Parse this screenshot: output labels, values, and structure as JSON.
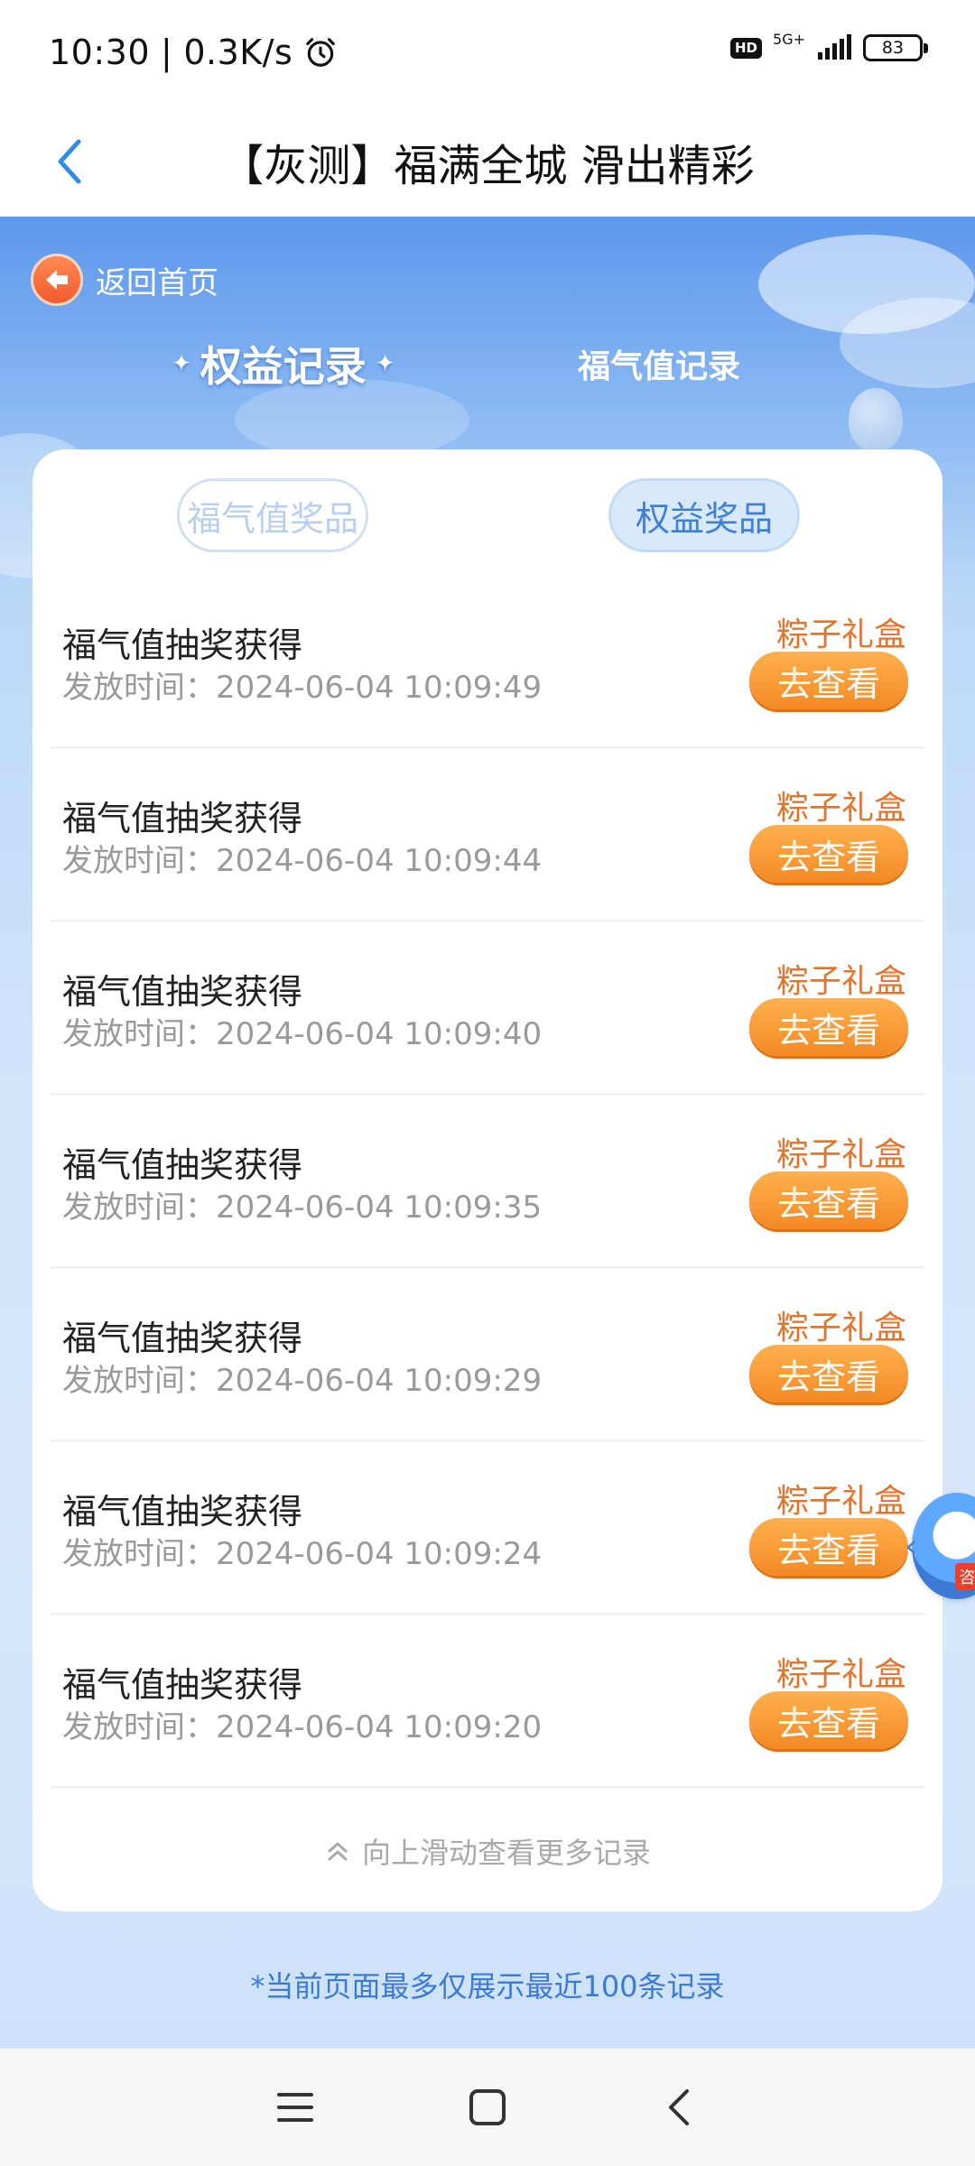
{
  "status_bar": {
    "time": "10:30",
    "speed": "0.3K/s",
    "hd": "HD",
    "network": "5G+",
    "battery": "83"
  },
  "nav": {
    "title": "【灰测】福满全城 滑出精彩"
  },
  "hero": {
    "back_home": "返回首页",
    "tab_active": "权益记录",
    "tab_inactive": "福气值记录"
  },
  "sub_tabs": {
    "left": "福气值奖品",
    "right": "权益奖品"
  },
  "records": [
    {
      "title": "福气值抽奖获得",
      "time_label": "发放时间：",
      "time": "2024-06-04 10:09:49",
      "prize": "粽子礼盒",
      "button": "去查看"
    },
    {
      "title": "福气值抽奖获得",
      "time_label": "发放时间：",
      "time": "2024-06-04 10:09:44",
      "prize": "粽子礼盒",
      "button": "去查看"
    },
    {
      "title": "福气值抽奖获得",
      "time_label": "发放时间：",
      "time": "2024-06-04 10:09:40",
      "prize": "粽子礼盒",
      "button": "去查看"
    },
    {
      "title": "福气值抽奖获得",
      "time_label": "发放时间：",
      "time": "2024-06-04 10:09:35",
      "prize": "粽子礼盒",
      "button": "去查看"
    },
    {
      "title": "福气值抽奖获得",
      "time_label": "发放时间：",
      "time": "2024-06-04 10:09:29",
      "prize": "粽子礼盒",
      "button": "去查看"
    },
    {
      "title": "福气值抽奖获得",
      "time_label": "发放时间：",
      "time": "2024-06-04 10:09:24",
      "prize": "粽子礼盒",
      "button": "去查看"
    },
    {
      "title": "福气值抽奖获得",
      "time_label": "发放时间：",
      "time": "2024-06-04 10:09:20",
      "prize": "粽子礼盒",
      "button": "去查看"
    }
  ],
  "more_hint": "向上滑动查看更多记录",
  "footer_note": "*当前页面最多仅展示最近100条记录",
  "float_service": {
    "label": "咨"
  },
  "icons": {
    "alarm": "alarm-clock-icon",
    "back": "chevron-left-icon",
    "home_back": "arrow-left-icon",
    "more": "double-chevron-up-icon",
    "menu": "menu-icon",
    "home": "square-home-icon",
    "sys_back": "sys-back-icon"
  },
  "colors": {
    "accent_blue": "#3d7ad6",
    "prize_orange": "#e5732b",
    "button_orange": "#f38a24"
  }
}
